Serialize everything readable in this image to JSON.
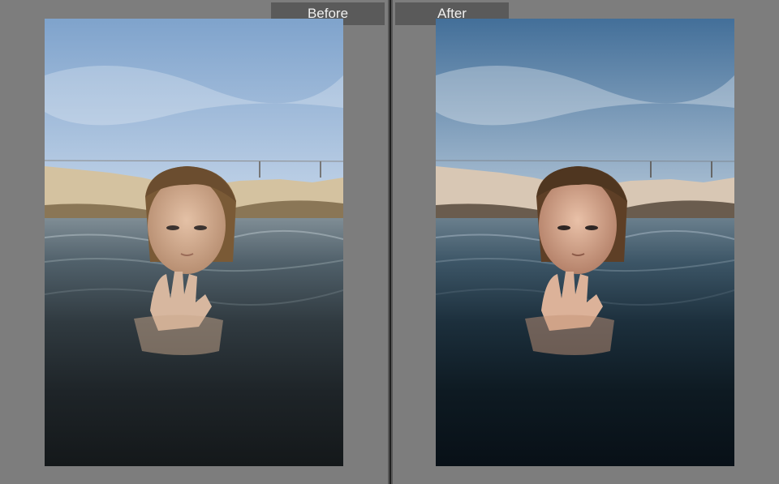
{
  "compare_view": {
    "before": {
      "label": "Before"
    },
    "after": {
      "label": "After"
    }
  },
  "colors": {
    "background": "#7c7c7c",
    "label_tab": "#5a5a5a",
    "divider": "#1f1f1f"
  }
}
